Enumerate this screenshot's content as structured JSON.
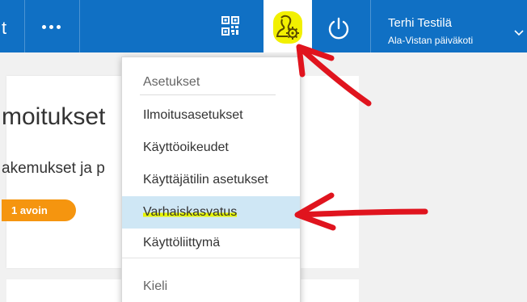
{
  "header": {
    "left_label": "t",
    "user_name": "Terhi Testilä",
    "user_unit": "Ala-Vistan päiväkoti"
  },
  "background": {
    "title": "moitukset",
    "line": "akemukset ja p",
    "badge": "1 avoin"
  },
  "dropdown": {
    "header": "Asetukset",
    "items": [
      {
        "label": "Ilmoitusasetukset"
      },
      {
        "label": "Käyttöoikeudet"
      },
      {
        "label": "Käyttäjätilin asetukset"
      },
      {
        "label": "Varhaiskasvatus"
      },
      {
        "label": "Käyttöliittymä"
      }
    ],
    "section2": "Kieli"
  },
  "colors": {
    "topbar": "#1070c4",
    "highlight": "#f2f000",
    "selected_row": "#cfe7f5",
    "badge": "#f5950f",
    "annotation": "#e0141e"
  },
  "icons": [
    "more-icon",
    "qr-code-icon",
    "user-settings-icon",
    "power-icon",
    "chevron-down-icon"
  ]
}
